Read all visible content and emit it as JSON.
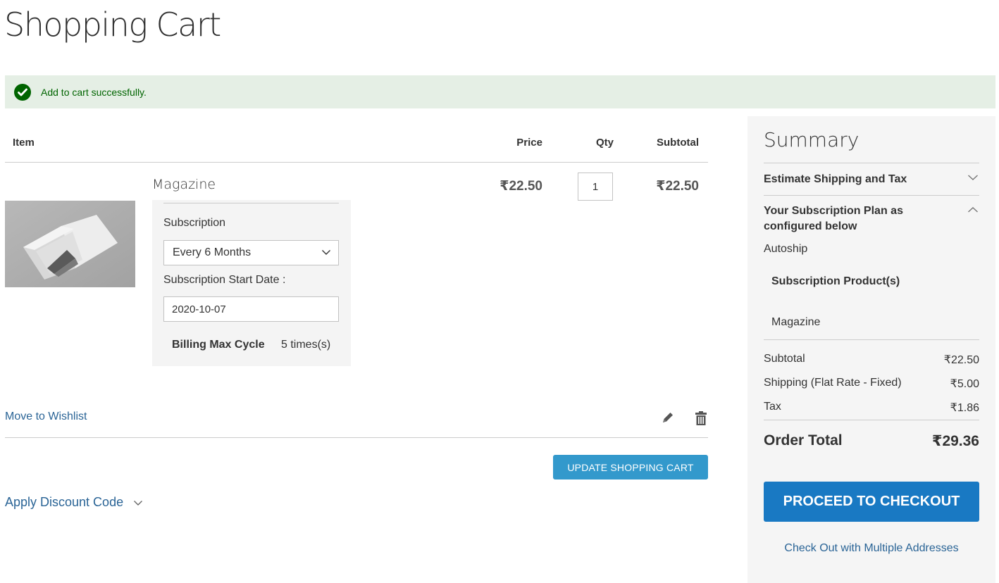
{
  "page": {
    "title": "Shopping Cart"
  },
  "message": {
    "icon": "check-circle-icon",
    "text": "Add to cart successfully.",
    "color": "#006400",
    "background": "#e5efe5"
  },
  "cart": {
    "headers": {
      "item": "Item",
      "price": "Price",
      "qty": "Qty",
      "subtotal": "Subtotal"
    },
    "items": [
      {
        "name": "Magazine",
        "image": "open-magazine-photo",
        "price": "₹22.50",
        "qty": "1",
        "subtotal": "₹22.50",
        "subscription": {
          "label": "Subscription",
          "selected": "Every 6 Months",
          "start_date_label": "Subscription Start Date :",
          "start_date": "2020-10-07",
          "billing_label": "Billing Max Cycle",
          "billing_value": "5 times(s)"
        },
        "actions": {
          "wishlist": "Move to Wishlist",
          "edit_icon": "pencil-icon",
          "delete_icon": "trash-icon"
        }
      }
    ],
    "update_button": "UPDATE SHOPPING CART",
    "discount_label": "Apply Discount Code"
  },
  "summary": {
    "title": "Summary",
    "estimate_shipping": "Estimate Shipping and Tax",
    "subscription_plan_title": "Your Subscription Plan as configured below",
    "plan_type": "Autoship",
    "products_heading": "Subscription Product(s)",
    "products": [
      "Magazine"
    ],
    "rows": [
      {
        "label": "Subtotal",
        "value": "₹22.50"
      },
      {
        "label": "Shipping (Flat Rate - Fixed)",
        "value": "₹5.00"
      },
      {
        "label": "Tax",
        "value": "₹1.86"
      }
    ],
    "order_total_label": "Order Total",
    "order_total_value": "₹29.36",
    "checkout_button": "PROCEED TO CHECKOUT",
    "multi_address_link": "Check Out with Multiple Addresses"
  },
  "colors": {
    "primary_button": "#1979c3",
    "secondary_button": "#3399cc",
    "link": "#2a6496",
    "summary_bg": "#f5f5f5"
  }
}
